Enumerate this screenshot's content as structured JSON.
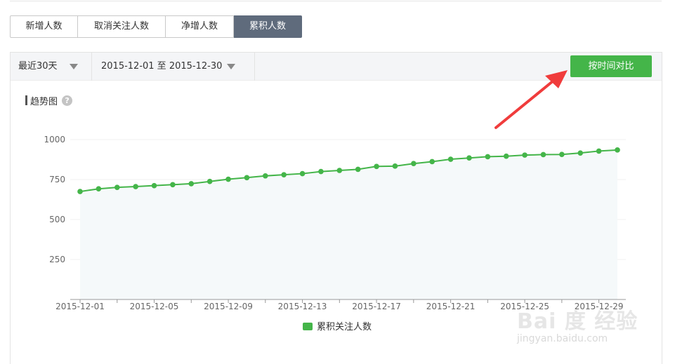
{
  "tabs": [
    {
      "label": "新增人数",
      "active": false
    },
    {
      "label": "取消关注人数",
      "active": false
    },
    {
      "label": "净增人数",
      "active": false
    },
    {
      "label": "累积人数",
      "active": true
    }
  ],
  "filters": {
    "range_label": "最近30天",
    "date_range": "2015-12-01 至 2015-12-30",
    "compare_button": "按时间对比"
  },
  "trend": {
    "title": "趋势图",
    "help_glyph": "?"
  },
  "colors": {
    "accent": "#44b549",
    "active_tab": "#5f6b7c",
    "annotation_arrow": "#f03c3c"
  },
  "chart_data": {
    "type": "line",
    "x": [
      "2015-12-01",
      "2015-12-02",
      "2015-12-03",
      "2015-12-04",
      "2015-12-05",
      "2015-12-06",
      "2015-12-07",
      "2015-12-08",
      "2015-12-09",
      "2015-12-10",
      "2015-12-11",
      "2015-12-12",
      "2015-12-13",
      "2015-12-14",
      "2015-12-15",
      "2015-12-16",
      "2015-12-17",
      "2015-12-18",
      "2015-12-19",
      "2015-12-20",
      "2015-12-21",
      "2015-12-22",
      "2015-12-23",
      "2015-12-24",
      "2015-12-25",
      "2015-12-26",
      "2015-12-27",
      "2015-12-28",
      "2015-12-29",
      "2015-12-30"
    ],
    "series": [
      {
        "name": "累积关注人数",
        "values": [
          675,
          692,
          701,
          706,
          712,
          718,
          724,
          738,
          752,
          762,
          773,
          780,
          787,
          800,
          807,
          814,
          832,
          834,
          850,
          862,
          877,
          885,
          893,
          896,
          903,
          906,
          907,
          916,
          928,
          935
        ]
      }
    ],
    "x_tick_labels": [
      "2015-12-01",
      "2015-12-05",
      "2015-12-09",
      "2015-12-13",
      "2015-12-17",
      "2015-12-21",
      "2015-12-25",
      "2015-12-29"
    ],
    "y_ticks": [
      250,
      500,
      750,
      1000
    ],
    "ylim": [
      0,
      1000
    ],
    "grid": true,
    "legend_position": "bottom-center"
  }
}
